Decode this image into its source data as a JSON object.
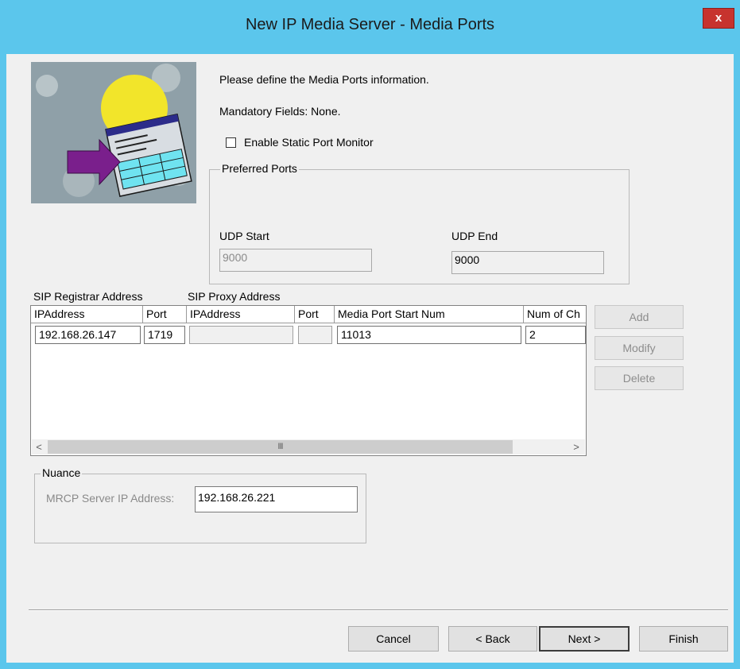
{
  "window": {
    "title": "New IP Media Server - Media Ports",
    "close_label": "x"
  },
  "intro": {
    "line1": "Please define the Media Ports information.",
    "line2": "Mandatory Fields: None."
  },
  "static_port_monitor": {
    "label": "Enable Static Port Monitor",
    "checked": false
  },
  "preferred_ports": {
    "title": "Preferred Ports",
    "udp_start_label": "UDP Start",
    "udp_start_value": "9000",
    "udp_end_label": "UDP End",
    "udp_end_value": "9000"
  },
  "table": {
    "registrar_label": "SIP Registrar Address",
    "proxy_label": "SIP Proxy Address",
    "columns": [
      "IPAddress",
      "Port",
      "IPAddress",
      "Port",
      "Media Port Start Num",
      "Num of Ch"
    ],
    "rows": [
      [
        "192.168.26.147",
        "1719",
        "",
        "",
        "11013",
        "2"
      ]
    ],
    "scroll_left": "<",
    "scroll_right": ">",
    "scroll_grip": "III"
  },
  "side_buttons": {
    "add": "Add",
    "modify": "Modify",
    "delete": "Delete"
  },
  "nuance": {
    "title": "Nuance",
    "mrcp_label": "MRCP Server IP Address:",
    "mrcp_value": "192.168.26.221"
  },
  "footer": {
    "cancel": "Cancel",
    "back": "< Back",
    "next": "Next >",
    "finish": "Finish"
  },
  "colors": {
    "titlebar": "#5bc6ec",
    "close": "#c7332e",
    "dialog_bg": "#f0f0f0"
  }
}
